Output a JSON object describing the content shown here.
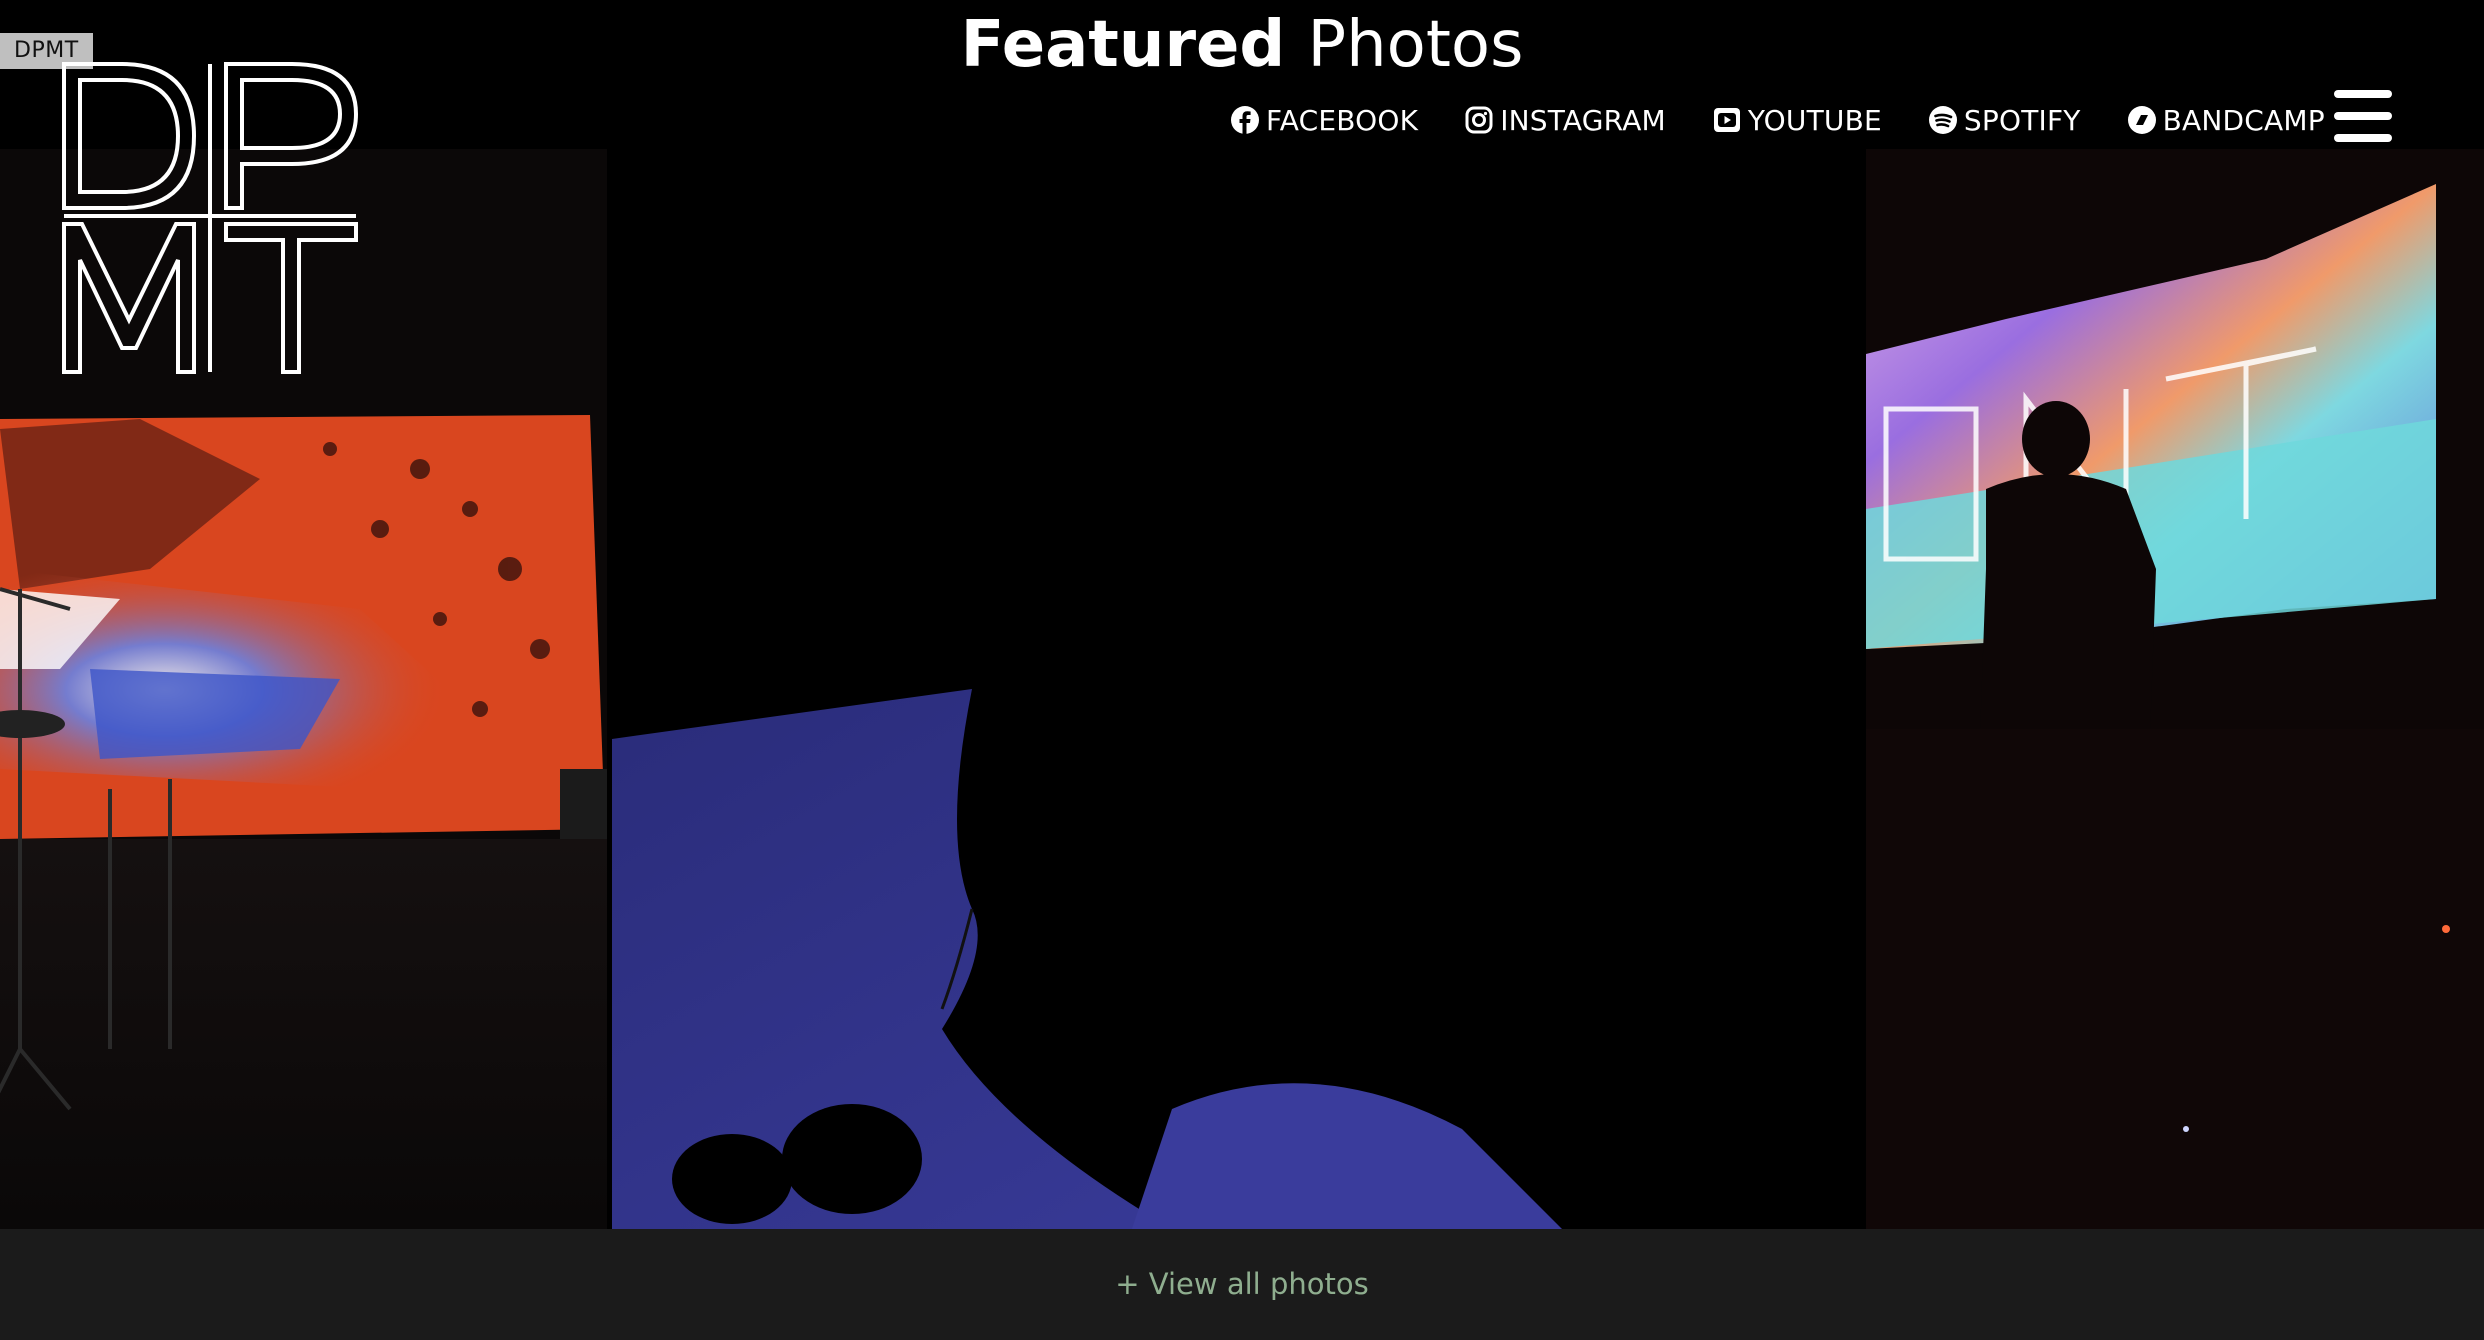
{
  "site": {
    "tag": "DPMT",
    "logo_letters": [
      "D",
      "P",
      "M",
      "T"
    ]
  },
  "header": {
    "title_bold": "Featured",
    "title_light": "Photos"
  },
  "social_nav": [
    {
      "label": "FACEBOOK",
      "icon": "facebook-icon"
    },
    {
      "label": "INSTAGRAM",
      "icon": "instagram-icon"
    },
    {
      "label": "YOUTUBE",
      "icon": "youtube-icon"
    },
    {
      "label": "SPOTIFY",
      "icon": "spotify-icon"
    },
    {
      "label": "BANDCAMP",
      "icon": "bandcamp-icon"
    }
  ],
  "menu": {
    "icon": "hamburger-menu-icon"
  },
  "photos": [
    {
      "name": "photo-stage-orange-projection"
    },
    {
      "name": "photo-silhouette-blue"
    },
    {
      "name": "photo-silhouette-projection-screen"
    }
  ],
  "footer": {
    "view_all_label": "+ View all photos"
  },
  "colors": {
    "background": "#000000",
    "footer_background": "#1b1b1b",
    "link_green": "#8fae8f",
    "tag_gray": "#bfbfbf"
  }
}
